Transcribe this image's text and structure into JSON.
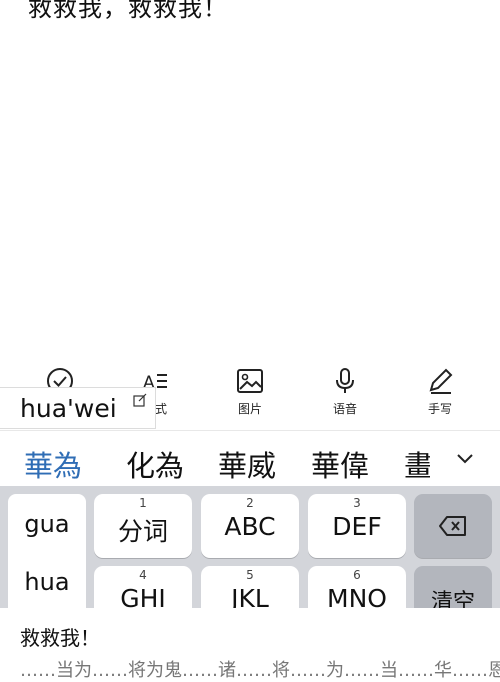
{
  "note": {
    "text": "救救我，救救我！"
  },
  "toolbar": {
    "items": [
      {
        "label": "",
        "icon": "check-circle-icon"
      },
      {
        "label": "样式",
        "icon": "text-format-icon"
      },
      {
        "label": "图片",
        "icon": "image-icon"
      },
      {
        "label": "语音",
        "icon": "microphone-icon"
      },
      {
        "label": "手写",
        "icon": "pen-icon"
      }
    ]
  },
  "composition": {
    "text": "hua'wei",
    "icon": "edit-icon"
  },
  "candidates": [
    "華為",
    "化為",
    "華威",
    "華偉",
    "畫"
  ],
  "pinyin_options": [
    "gua",
    "hua"
  ],
  "keys": [
    {
      "num": "1",
      "label": "分词"
    },
    {
      "num": "2",
      "label": "ABC"
    },
    {
      "num": "3",
      "label": "DEF"
    },
    {
      "num": "4",
      "label": "GHI"
    },
    {
      "num": "5",
      "label": "JKL"
    },
    {
      "num": "6",
      "label": "MNO"
    }
  ],
  "function_keys": {
    "delete_icon": "backspace-icon",
    "clear": "清空"
  },
  "colors": {
    "candidate_highlight": "#2f6db5",
    "keyboard_bg": "#d3d5da"
  },
  "bottom_text": {
    "line1": "救救我！",
    "line2": "……当为……将为鬼……诸……将……为……当……华……恩"
  }
}
